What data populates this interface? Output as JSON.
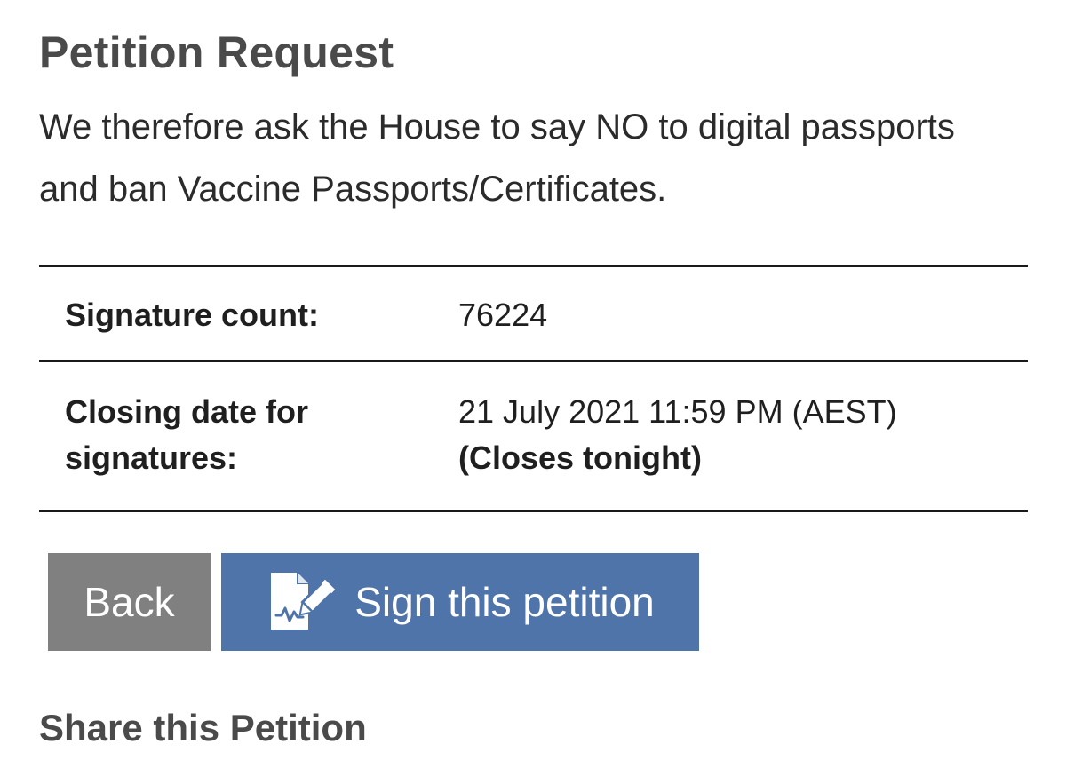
{
  "page": {
    "title": "Petition Request",
    "request_text": "We therefore ask the House to say NO to digital passports and ban Vaccine Passports/Certificates."
  },
  "details": {
    "signature_count_label": "Signature count:",
    "signature_count_value": "76224",
    "closing_label_line1": "Closing date for",
    "closing_label_line2": "signatures:",
    "closing_value": "21 July 2021 11:59 PM (AEST)",
    "closing_note": "(Closes tonight)"
  },
  "actions": {
    "back_label": "Back",
    "sign_label": "Sign this petition",
    "sign_icon": "sign-document-icon"
  },
  "share": {
    "heading": "Share this Petition"
  },
  "colors": {
    "sign_button": "#4f74a9",
    "back_button": "#808080"
  }
}
